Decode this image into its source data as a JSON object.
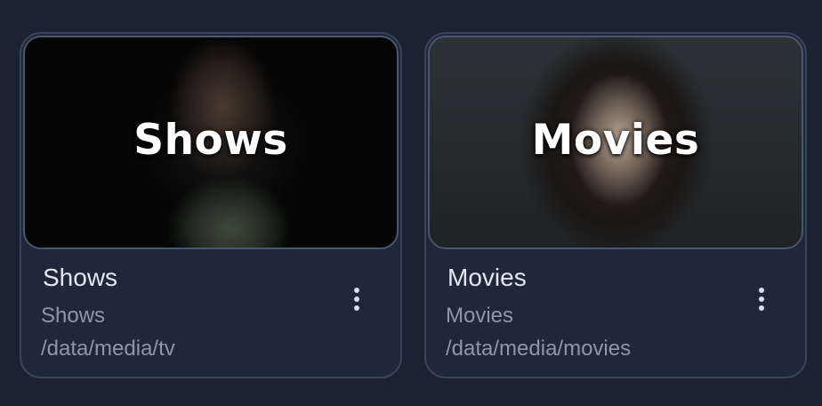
{
  "libraries": [
    {
      "banner_text": "Shows",
      "title": "Shows",
      "type": "Shows",
      "path": "/data/media/tv",
      "menu_icon": "more-vertical-icon"
    },
    {
      "banner_text": "Movies",
      "title": "Movies",
      "type": "Movies",
      "path": "/data/media/movies",
      "menu_icon": "more-vertical-icon"
    }
  ],
  "colors": {
    "background": "#1b2333",
    "card": "#1f283a",
    "border": "#394459",
    "title_text": "#e3e7ee",
    "secondary_text": "#8e97a7"
  }
}
